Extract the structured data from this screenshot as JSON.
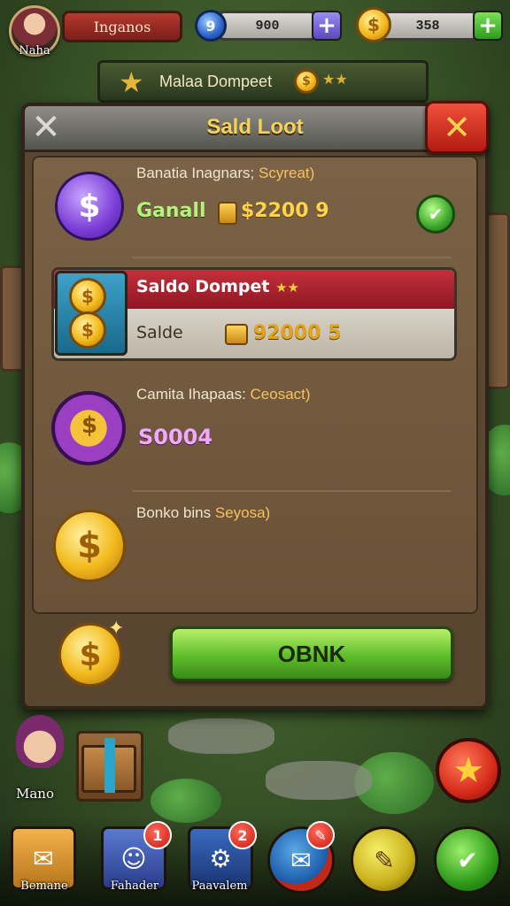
{
  "hud": {
    "avatar_name": "Naha",
    "player_name": "Inganos",
    "gems": "900",
    "coins": "358",
    "plus": "+"
  },
  "banner": {
    "title": "Malaa Dompeet",
    "stars": "★★"
  },
  "dialog": {
    "title": "Sald Loot",
    "close": "✕",
    "back": "✕",
    "rows": [
      {
        "heading": "Banatia Inagnars;",
        "heading_em": "Scyreat)",
        "label": "Ganall",
        "amount": "$2200 9",
        "icon_glyph": "$"
      },
      {
        "heading": "Saldo Dompet",
        "heading_em": "★★",
        "sub": "Salde",
        "amount": "92000 5",
        "icon_glyph": "$"
      },
      {
        "heading": "Camita Ihapaas:",
        "heading_em": "Ceosact)",
        "amount": "S0004",
        "icon_glyph": "$"
      },
      {
        "heading": "Bonko bins",
        "heading_em": "Seyosa)",
        "icon_glyph": "$"
      }
    ],
    "ok_label": "OBNK",
    "footer_coin_glyph": "$"
  },
  "scene": {
    "npc_name": "Mano",
    "star_glyph": "★"
  },
  "bottom_nav": [
    {
      "label": "Bemane",
      "glyph": "✉",
      "badge": ""
    },
    {
      "label": "Fahader",
      "glyph": "☺",
      "badge": "1"
    },
    {
      "label": "Paavalem",
      "glyph": "⚙",
      "badge": "2"
    },
    {
      "label": "",
      "glyph": "✉",
      "badge": "✎"
    },
    {
      "label": "",
      "glyph": "✎",
      "badge": ""
    },
    {
      "label": "",
      "glyph": "✔",
      "badge": ""
    }
  ],
  "colors": {
    "accent_gold": "#f5d25a",
    "ok_green": "#5dbd2a",
    "close_red": "#d62a1a",
    "wallet_red": "#c4303c"
  }
}
